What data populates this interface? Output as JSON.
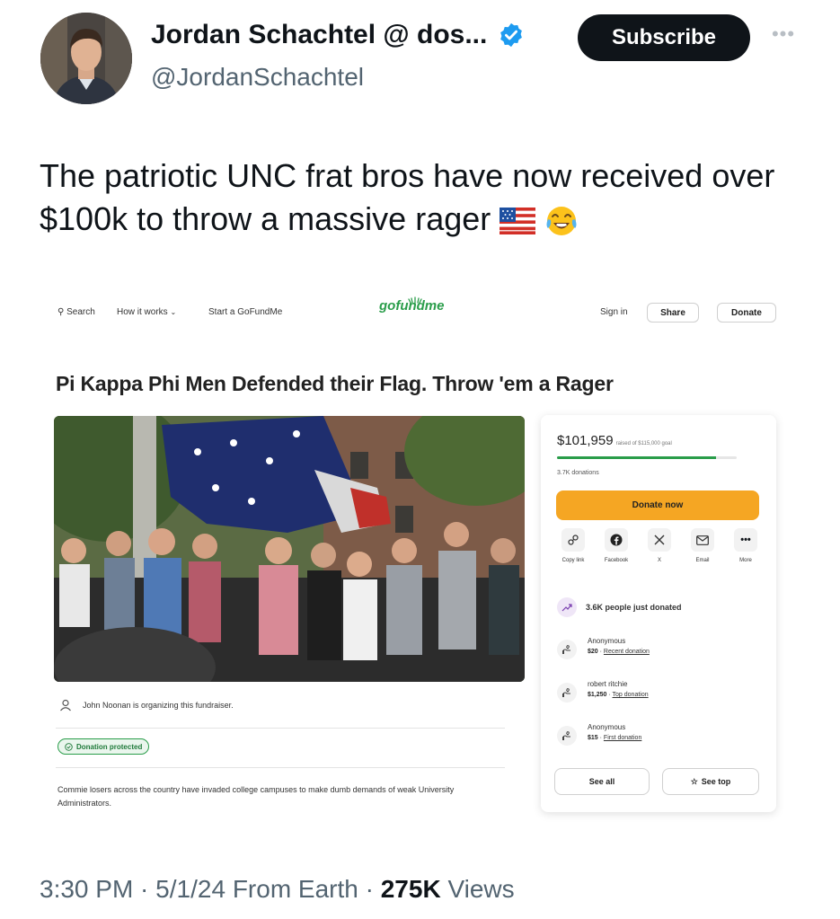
{
  "author": {
    "display_name": "Jordan Schachtel @ dos...",
    "handle": "@JordanSchachtel",
    "verified_icon": "verified-badge-icon",
    "verified_color": "#1d9bf0"
  },
  "subscribe_label": "Subscribe",
  "more_icon": "more-dots-icon",
  "tweet": {
    "text": "The patriotic UNC frat bros have now received over $100k to throw a massive rager",
    "emojis": [
      "us-flag-emoji",
      "tears-of-joy-emoji"
    ]
  },
  "gofundme": {
    "nav": {
      "search": "Search",
      "how_it_works": "How it works",
      "start": "Start a GoFundMe",
      "logo": "gofundme",
      "sign_in": "Sign in",
      "share": "Share",
      "donate": "Donate"
    },
    "campaign_title": "Pi Kappa Phi Men Defended their Flag. Throw 'em a Rager",
    "organizer_text": "John Noonan is organizing this fundraiser.",
    "protected_label": "Donation protected",
    "story": "Commie losers across the country have invaded college campuses to make dumb demands of weak University Administrators.",
    "card": {
      "raised": "$101,959",
      "goal_text": "raised of $115,000 goal",
      "progress_fraction": 0.886,
      "donations_count": "3.7K donations",
      "donate_now": "Donate now",
      "share_options": [
        {
          "label": "Copy link",
          "icon": "link-icon"
        },
        {
          "label": "Facebook",
          "icon": "facebook-icon"
        },
        {
          "label": "X",
          "icon": "x-logo-icon"
        },
        {
          "label": "Email",
          "icon": "email-icon"
        },
        {
          "label": "More",
          "icon": "more-dots-icon"
        }
      ],
      "trend_text": "3.6K people just donated",
      "donors": [
        {
          "name": "Anonymous",
          "amount": "$20",
          "tag": "Recent donation"
        },
        {
          "name": "robert ritchie",
          "amount": "$1,250",
          "tag": "Top donation"
        },
        {
          "name": "Anonymous",
          "amount": "$15",
          "tag": "First donation"
        }
      ],
      "see_all": "See all",
      "see_top": "See top"
    },
    "accent_green": "#2a9d4a",
    "accent_orange": "#f5a623"
  },
  "footer": {
    "time": "3:30 PM",
    "date": "5/1/24",
    "location": "From Earth",
    "views_count": "275K",
    "views_label": "Views"
  }
}
